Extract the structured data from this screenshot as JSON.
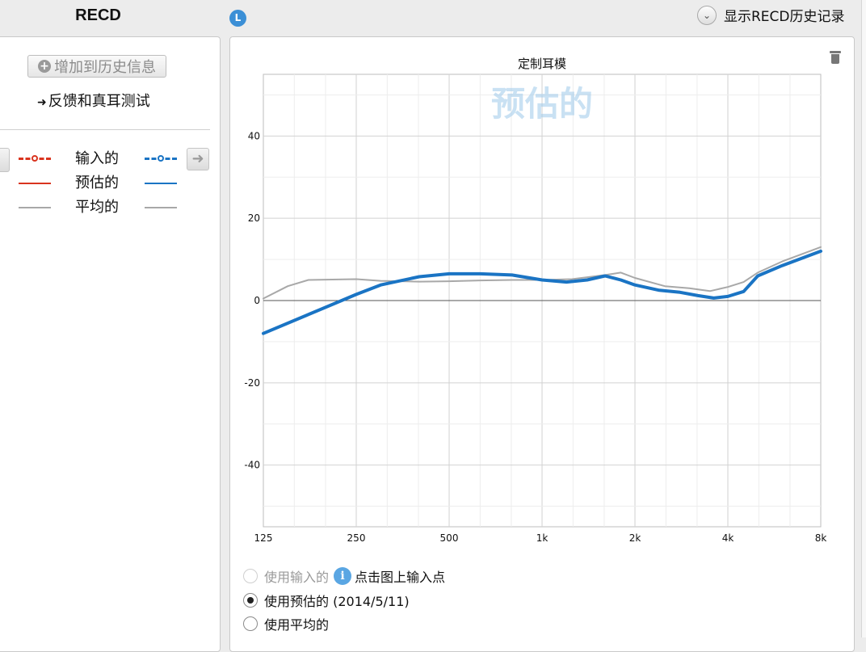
{
  "left_panel": {
    "title": "RECD",
    "add_history_button": "增加到历史信息",
    "feedback_link": "反馈和真耳测试",
    "legend": [
      {
        "label": "输入的",
        "left_style": "dashed-circle",
        "right_style": "dashed-circle"
      },
      {
        "label": "预估的",
        "left_style": "solid",
        "right_style": "solid"
      },
      {
        "label": "平均的",
        "left_style": "solid-gray",
        "right_style": "solid-gray"
      }
    ],
    "colors": {
      "left_ear": "#d9341f",
      "right_ear": "#1a74c4",
      "average": "#a8a8a8"
    }
  },
  "header": {
    "side_badge": "L",
    "history_toggle": "显示RECD历史记录"
  },
  "chart_data": {
    "type": "line",
    "title": "定制耳模",
    "watermark": "预估的",
    "x_scale": "log",
    "x_ticks": [
      "125",
      "250",
      "500",
      "1k",
      "2k",
      "4k",
      "8k"
    ],
    "y_ticks": [
      "40",
      "20",
      "0",
      "-20",
      "-40"
    ],
    "xlim": [
      125,
      8000
    ],
    "ylim": [
      -55,
      55
    ],
    "grid": true,
    "series": [
      {
        "color": "#a8a8a8",
        "x": [
          125,
          150,
          175,
          250,
          300,
          400,
          500,
          630,
          800,
          1000,
          1250,
          1600,
          1800,
          2000,
          2500,
          3000,
          3500,
          4000,
          4500,
          5000,
          6000,
          8000
        ],
        "y": [
          0.5,
          3.5,
          5.0,
          5.2,
          4.8,
          4.6,
          4.7,
          4.9,
          5.0,
          5.0,
          5.2,
          6.2,
          6.8,
          5.5,
          3.5,
          3.0,
          2.3,
          3.3,
          4.5,
          6.8,
          9.5,
          13.0
        ]
      },
      {
        "color": "#1a74c4",
        "x": [
          125,
          250,
          300,
          400,
          500,
          630,
          800,
          1000,
          1200,
          1400,
          1600,
          1800,
          2000,
          2400,
          2800,
          3200,
          3600,
          4000,
          4500,
          5000,
          6000,
          8000
        ],
        "y": [
          -8.0,
          1.5,
          3.8,
          5.8,
          6.5,
          6.5,
          6.2,
          5.0,
          4.5,
          5.0,
          6.0,
          5.0,
          3.8,
          2.5,
          2.0,
          1.2,
          0.6,
          1.0,
          2.2,
          6.0,
          8.5,
          12.0
        ]
      }
    ]
  },
  "options": {
    "use_input": "使用输入的",
    "info_hint": "点击图上输入点",
    "use_estimated": "使用预估的 (2014/5/11)",
    "use_average": "使用平均的",
    "selected": "use_estimated"
  }
}
